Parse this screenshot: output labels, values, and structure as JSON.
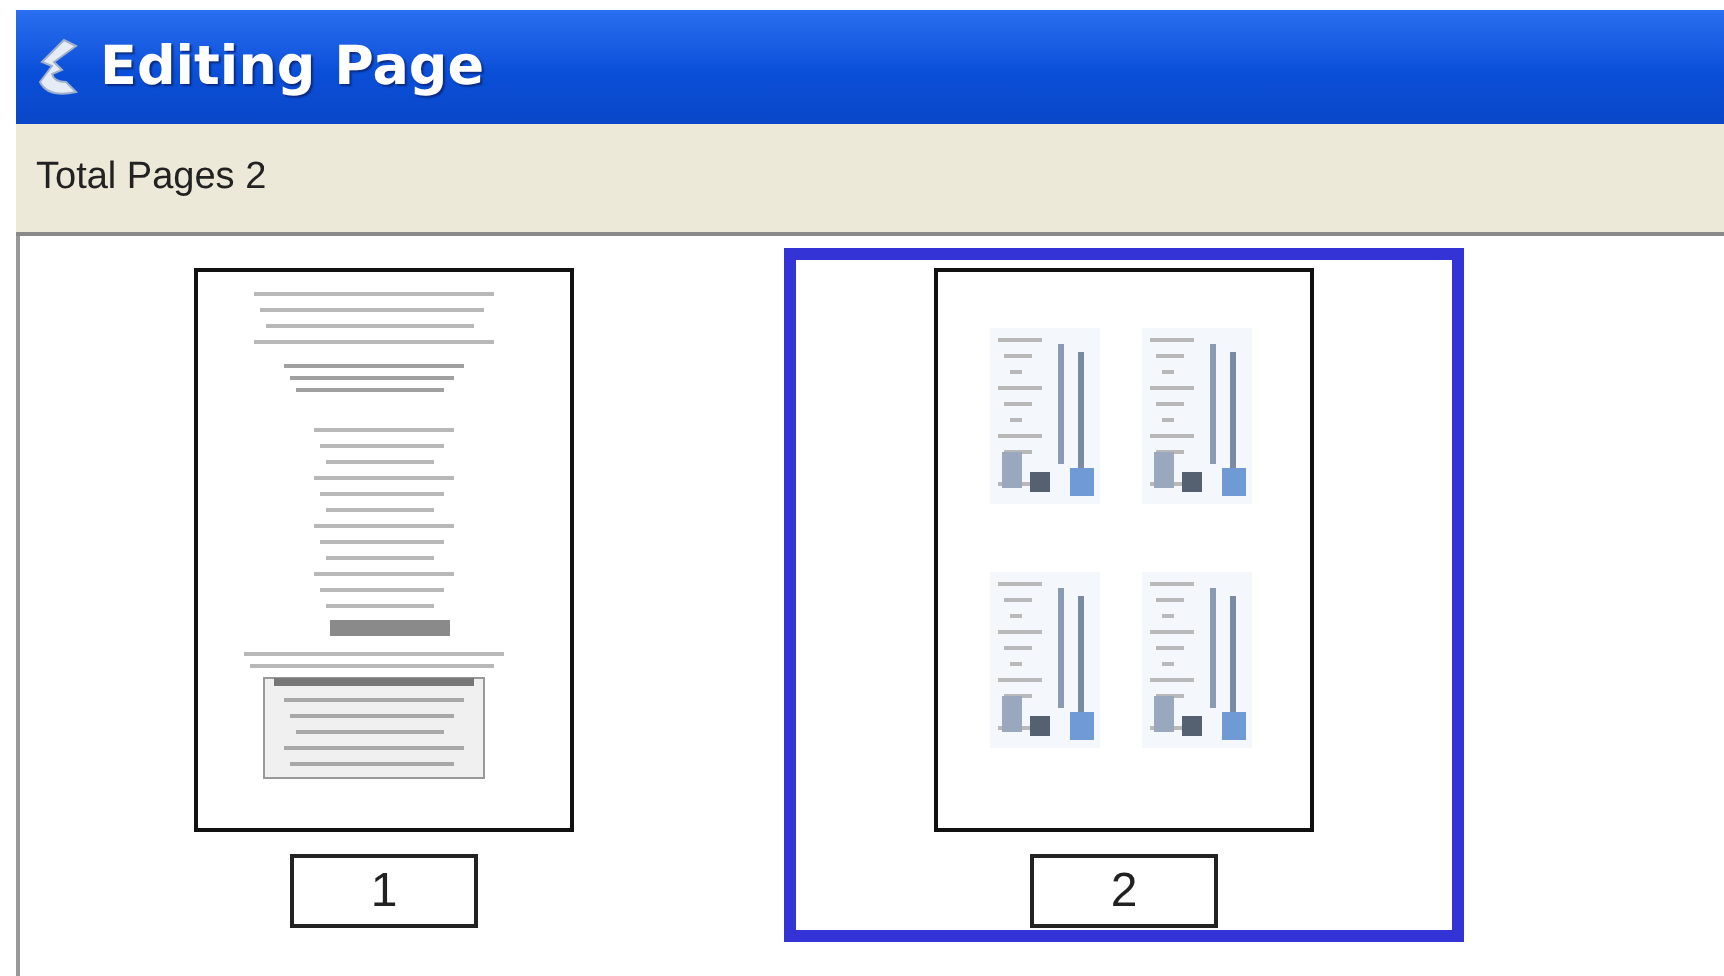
{
  "window": {
    "title": "Editing Page"
  },
  "summary": "Total Pages 2",
  "pages": [
    {
      "label": "1",
      "kind": "document",
      "selected": false
    },
    {
      "label": "2",
      "kind": "four-up",
      "selected": true
    }
  ]
}
